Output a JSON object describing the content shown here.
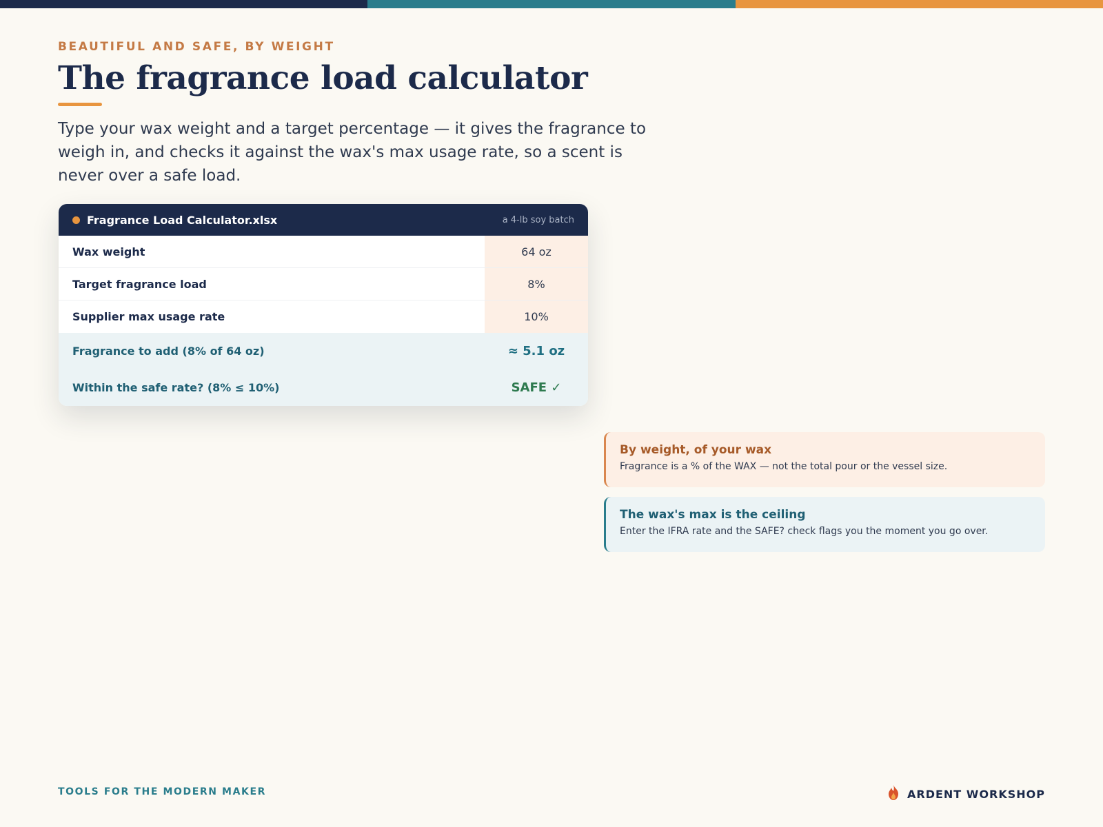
{
  "colors": {
    "navy": "#1c2a4a",
    "teal": "#2a7d8c",
    "orange": "#e8953f",
    "input_bg": "#fdefe5",
    "output_bg": "#ebf3f5",
    "safe_green": "#2e7a4f",
    "page_bg": "#fbf9f3"
  },
  "header": {
    "eyebrow": "BEAUTIFUL AND SAFE, BY WEIGHT",
    "title": "The fragrance load calculator",
    "lede": "Type your wax weight and a target percentage — it gives the fragrance to weigh in, and checks it against the wax's max usage rate, so a scent is never over a safe load."
  },
  "spreadsheet": {
    "filename": "Fragrance Load Calculator.xlsx",
    "batch_note": "a 4-lb soy batch",
    "inputs": [
      {
        "label": "Wax weight",
        "value": "64 oz"
      },
      {
        "label": "Target fragrance load",
        "value": "8%"
      },
      {
        "label": "Supplier max usage rate",
        "value": "10%"
      }
    ],
    "outputs": [
      {
        "label": "Fragrance to add (8% of 64 oz)",
        "value": "≈ 5.1 oz"
      },
      {
        "label": "Within the safe rate? (8% ≤ 10%)",
        "value": "SAFE ✓"
      }
    ]
  },
  "callouts": [
    {
      "heading": "By weight, of your wax",
      "body": "Fragrance is a % of the WAX — not the total pour or the vessel size."
    },
    {
      "heading": "The wax's max is the ceiling",
      "body": "Enter the IFRA rate and the SAFE? check flags you the moment you go over."
    }
  ],
  "footer": {
    "tagline": "TOOLS FOR THE MODERN MAKER",
    "brand": "ARDENT WORKSHOP",
    "brand_icon": "flame-icon"
  }
}
